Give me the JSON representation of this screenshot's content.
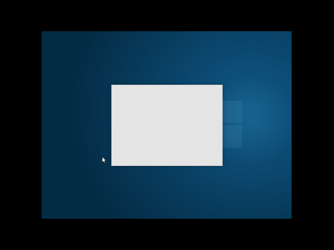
{
  "screen": {
    "background": "desktop-wallpaper",
    "colors": {
      "outer_frame": "#000000",
      "wallpaper_dark": "#042b45",
      "wallpaper_light": "#0f5a86",
      "dialog": "#e4e4e4"
    }
  },
  "dialog": {
    "title": "",
    "body": ""
  },
  "cursor": {
    "icon": "mouse-pointer-icon"
  }
}
